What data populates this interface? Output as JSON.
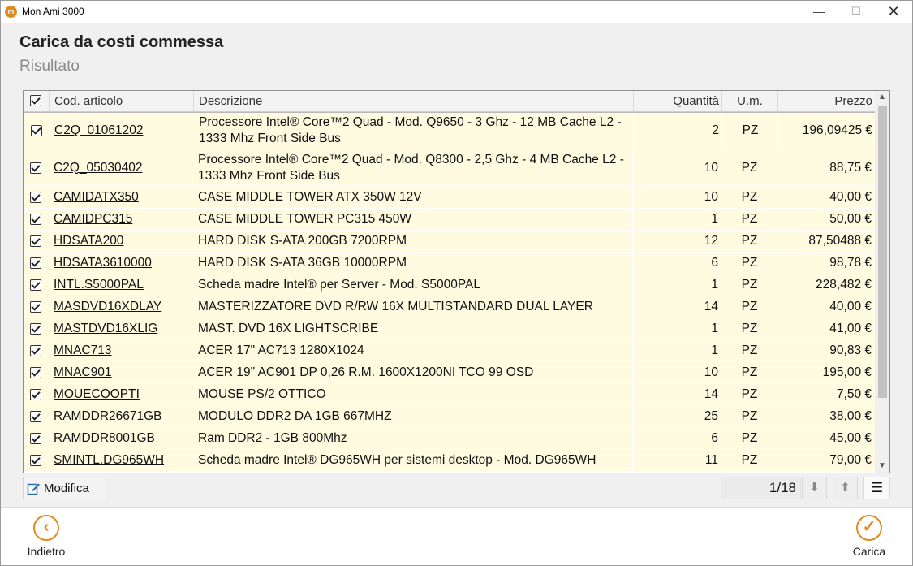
{
  "window": {
    "app_title": "Mon Ami 3000",
    "app_icon_glyph": "m",
    "minimize_glyph": "—",
    "maximize_glyph": "☐",
    "close_glyph": "✕"
  },
  "header": {
    "title": "Carica da costi commessa",
    "subtitle": "Risultato"
  },
  "grid": {
    "columns": {
      "code": "Cod. articolo",
      "description": "Descrizione",
      "quantity": "Quantità",
      "um": "U.m.",
      "price": "Prezzo"
    },
    "rows": [
      {
        "code": "C2Q_01061202",
        "description": "Processore Intel® Core™2 Quad - Mod. Q9650 - 3 Ghz - 12 MB Cache L2 - 1333 Mhz Front Side Bus",
        "quantity": "2",
        "um": "PZ",
        "price": "196,09425 €",
        "checked": true,
        "tall": true,
        "selected": true
      },
      {
        "code": "C2Q_05030402",
        "description": "Processore Intel® Core™2 Quad - Mod. Q8300 - 2,5 Ghz - 4 MB Cache L2 - 1333 Mhz Front Side Bus",
        "quantity": "10",
        "um": "PZ",
        "price": "88,75 €",
        "checked": true,
        "tall": true
      },
      {
        "code": "CAMIDATX350",
        "description": "CASE MIDDLE TOWER ATX  350W 12V",
        "quantity": "10",
        "um": "PZ",
        "price": "40,00 €",
        "checked": true
      },
      {
        "code": "CAMIDPC315",
        "description": "CASE MIDDLE TOWER PC315 450W",
        "quantity": "1",
        "um": "PZ",
        "price": "50,00 €",
        "checked": true
      },
      {
        "code": "HDSATA200",
        "description": "HARD DISK S-ATA 200GB 7200RPM",
        "quantity": "12",
        "um": "PZ",
        "price": "87,50488 €",
        "checked": true
      },
      {
        "code": "HDSATA3610000",
        "description": "HARD DISK S-ATA 36GB 10000RPM",
        "quantity": "6",
        "um": "PZ",
        "price": "98,78 €",
        "checked": true
      },
      {
        "code": "INTL.S5000PAL",
        "description": "Scheda madre Intel® per Server - Mod. S5000PAL",
        "quantity": "1",
        "um": "PZ",
        "price": "228,482 €",
        "checked": true
      },
      {
        "code": "MASDVD16XDLAY",
        "description": "MASTERIZZATORE DVD R/RW 16X MULTISTANDARD DUAL LAYER",
        "quantity": "14",
        "um": "PZ",
        "price": "40,00 €",
        "checked": true
      },
      {
        "code": "MASTDVD16XLIG",
        "description": "MAST.  DVD 16X  LIGHTSCRIBE",
        "quantity": "1",
        "um": "PZ",
        "price": "41,00 €",
        "checked": true
      },
      {
        "code": "MNAC713",
        "description": "ACER 17\" AC713 1280X1024",
        "quantity": "1",
        "um": "PZ",
        "price": "90,83 €",
        "checked": true
      },
      {
        "code": "MNAC901",
        "description": "ACER 19\" AC901 DP 0,26 R.M. 1600X1200NI TCO 99 OSD",
        "quantity": "10",
        "um": "PZ",
        "price": "195,00 €",
        "checked": true
      },
      {
        "code": "MOUECOOPTI",
        "description": "MOUSE PS/2 OTTICO",
        "quantity": "14",
        "um": "PZ",
        "price": "7,50 €",
        "checked": true
      },
      {
        "code": "RAMDDR26671GB",
        "description": "MODULO DDR2 DA 1GB 667MHZ",
        "quantity": "25",
        "um": "PZ",
        "price": "38,00 €",
        "checked": true
      },
      {
        "code": "RAMDDR8001GB",
        "description": "Ram DDR2 - 1GB 800Mhz",
        "quantity": "6",
        "um": "PZ",
        "price": "45,00 €",
        "checked": true
      },
      {
        "code": "SMINTL.DG965WH",
        "description": "Scheda madre Intel® DG965WH per sistemi desktop - Mod. DG965WH",
        "quantity": "11",
        "um": "PZ",
        "price": "79,00 €",
        "checked": true
      }
    ],
    "scroll_up_glyph": "▲",
    "scroll_down_glyph": "▼"
  },
  "toolbar": {
    "edit_label": "Modifica",
    "pager_text": "1/18",
    "down_glyph": "⬇",
    "up_glyph": "⬆",
    "menu_glyph": "☰"
  },
  "footer": {
    "back_label": "Indietro",
    "back_glyph": "‹",
    "ok_label": "Carica",
    "ok_glyph": "✓"
  },
  "colors": {
    "accent": "#e08a1e",
    "row_background": "#fffbe0"
  }
}
